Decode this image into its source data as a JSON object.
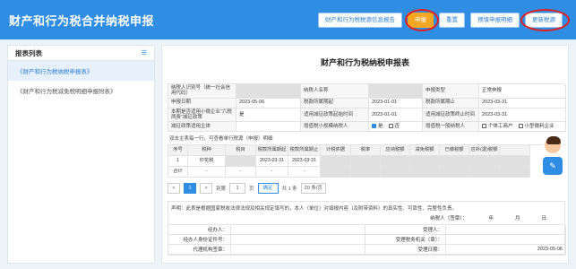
{
  "header": {
    "title": "财产和行为税合并纳税申报",
    "buttons": [
      "财产和行为税税源信息报告",
      "申报",
      "重置",
      "预填申报明细",
      "更新税源"
    ]
  },
  "sidebar": {
    "title": "报表列表",
    "items": [
      "《财产和行为税纳税申报表》",
      "《财产和行为税减免税明细申报附表》"
    ]
  },
  "form": {
    "title": "财产和行为税纳税申报表",
    "rows": [
      [
        "纳税人识别号（统一社会信用代码）",
        "",
        "纳税人名称",
        "",
        "申报类型",
        "正常申报"
      ],
      [
        "申报日期",
        "2023-05-06",
        "税款所属期起",
        "2023-01-01",
        "税款所属期止",
        "2023-03-31"
      ],
      [
        "本期是否适用小微企业“六税两费”减征政策",
        "是",
        "适用减征政策起始时间",
        "2023-01-01",
        "适用减征政策终止时间",
        "2023-03-31"
      ],
      [
        "减征政策适用主体",
        "",
        "增值税小规模纳税人",
        "",
        "增值税一般纳税人",
        ""
      ]
    ],
    "checkbox_labels": {
      "yes": "是",
      "no": "否",
      "individual": "个体工商户",
      "small": "小型微利企业"
    },
    "note": "双击主表每一行，可查看单行税源（申报）明细",
    "table_headers": [
      "序号",
      "税种",
      "税目",
      "税款所属期起",
      "税款所属期止",
      "计税依据",
      "税率",
      "应纳税额",
      "减免税额",
      "已缴税额",
      "应补(退)税额"
    ],
    "table_rows": [
      [
        "1",
        "印花税",
        "",
        "2023-03-31",
        "2023-03-31",
        "",
        "",
        "",
        "",
        "",
        ""
      ],
      [
        "合计",
        "-",
        "-",
        "-",
        "-",
        "",
        "",
        "",
        "",
        "",
        ""
      ]
    ]
  },
  "pager": {
    "page": "1",
    "goto_label": "到第",
    "page_input": "1",
    "page_unit": "页",
    "go_button": "确定",
    "total": "共 1 条",
    "size_select": "20 条/页"
  },
  "declaration": {
    "text": "声明：此表是根据国家税收法律法规及相关规定填写的，本人（单位）对填报内容（及附带资料）的真实性、可靠性、完整性负责。",
    "sign_label": "纳税人（签章）：",
    "year": "年",
    "month": "月",
    "day": "日",
    "rows": [
      [
        "经办人：",
        "",
        "受理人：",
        ""
      ],
      [
        "经办人身份证件号：",
        "",
        "受理税务机关（章）：",
        ""
      ],
      [
        "代理机构签章：",
        "",
        "受理日期：",
        "2023-05-06"
      ]
    ]
  }
}
